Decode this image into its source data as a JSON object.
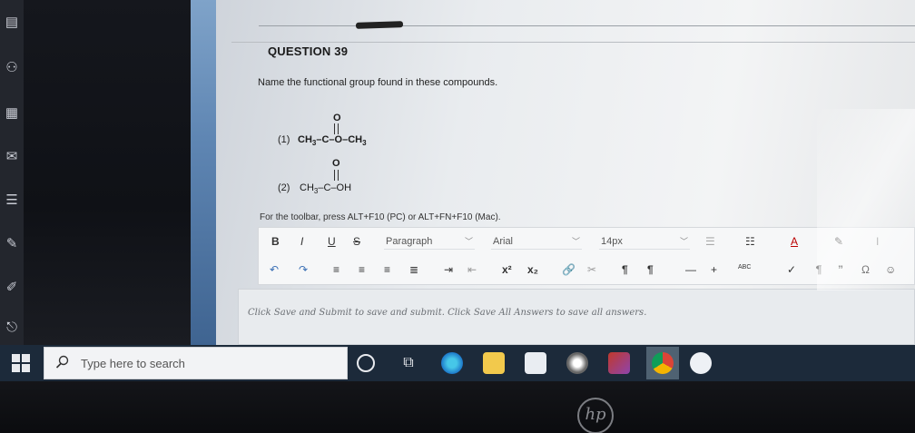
{
  "question": {
    "title": "QUESTION 39",
    "text": "Name the functional group found in these compounds.",
    "compounds": [
      {
        "number": "(1)",
        "left": "CH",
        "left_sub": "3",
        "bond1": "–",
        "carbon": "C",
        "bond2": "–O–",
        "right": "CH",
        "right_sub": "3",
        "top": "O"
      },
      {
        "number": "(2)",
        "left": "CH",
        "left_sub": "3",
        "bond1": "–",
        "carbon": "C",
        "bond2": "–",
        "right": "OH",
        "top": "O"
      }
    ]
  },
  "toolbar": {
    "hint": "For the toolbar, press ALT+F10 (PC) or ALT+FN+F10 (Mac).",
    "bold": "B",
    "italic": "I",
    "underline": "U",
    "strikethrough": "S",
    "paragraph_select": "Paragraph",
    "font_select": "Arial",
    "size_select": "14px",
    "superscript": "x²",
    "subscript": "x₂",
    "pilcrow_ltr": "¶",
    "pilcrow_rtl": "¶",
    "minus": "—",
    "plus": "+",
    "abc": "ABC",
    "check": "✓",
    "para_mark": "¶",
    "quote": "”",
    "omega": "Ω",
    "font_color": "A"
  },
  "editor": {
    "hint": "Click Save and Submit to save and submit. Click Save All Answers to save all answers."
  },
  "taskbar": {
    "search_placeholder": "Type here to search"
  },
  "bezel": {
    "logo": "hp"
  }
}
